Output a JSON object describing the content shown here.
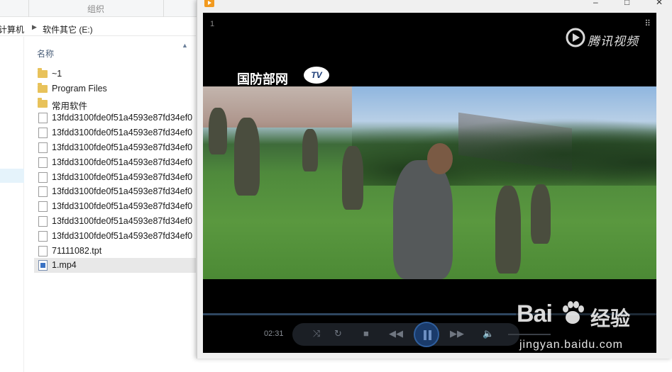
{
  "ribbon": {
    "group_label": "组织"
  },
  "breadcrumb": {
    "items": [
      "计算机",
      "软件其它 (E:)"
    ]
  },
  "file_list": {
    "column_header": "名称",
    "items": [
      {
        "name": "~1",
        "type": "folder",
        "selected": false
      },
      {
        "name": "Program Files",
        "type": "folder",
        "selected": false
      },
      {
        "name": "常用软件",
        "type": "folder",
        "selected": false
      },
      {
        "name": "13fdd3100fde0f51a4593e87fd34ef0",
        "type": "file",
        "selected": false
      },
      {
        "name": "13fdd3100fde0f51a4593e87fd34ef0",
        "type": "file",
        "selected": false
      },
      {
        "name": "13fdd3100fde0f51a4593e87fd34ef0",
        "type": "file",
        "selected": false
      },
      {
        "name": "13fdd3100fde0f51a4593e87fd34ef0",
        "type": "file",
        "selected": false
      },
      {
        "name": "13fdd3100fde0f51a4593e87fd34ef0",
        "type": "file",
        "selected": false
      },
      {
        "name": "13fdd3100fde0f51a4593e87fd34ef0",
        "type": "file",
        "selected": false
      },
      {
        "name": "13fdd3100fde0f51a4593e87fd34ef0",
        "type": "file",
        "selected": false
      },
      {
        "name": "13fdd3100fde0f51a4593e87fd34ef0",
        "type": "file",
        "selected": false
      },
      {
        "name": "13fdd3100fde0f51a4593e87fd34ef0",
        "type": "file",
        "selected": false
      },
      {
        "name": "71111082.tpt",
        "type": "file",
        "selected": false
      },
      {
        "name": "1.mp4",
        "type": "video",
        "selected": true
      }
    ]
  },
  "player": {
    "episode_number": "1",
    "brand_logo": "腾讯视频",
    "site_badge": "国防部网",
    "site_badge_tv": "TV",
    "elapsed_time": "02:31",
    "progress": 0.69,
    "window_controls": [
      "–",
      "□",
      "✕"
    ],
    "controls": {
      "prev_icon": "rewind-icon",
      "play_state": "playing",
      "next_icon": "fast-forward-icon",
      "volume_icon": "speaker-icon"
    }
  },
  "watermark": {
    "logo": "Bai",
    "logo_suffix": "经验",
    "url": "jingyan.baidu.com"
  }
}
